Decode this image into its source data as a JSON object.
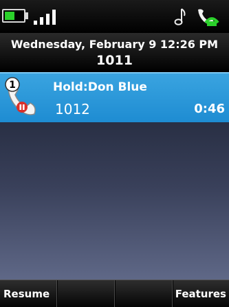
{
  "status": {
    "battery_level": 0.55,
    "signal_bars": 4,
    "icons": [
      "battery-icon",
      "signal-icon",
      "music-note-icon",
      "handset-icon"
    ],
    "colors": {
      "battery_fill": "#2bd12b",
      "handset_green": "#2bd12b"
    }
  },
  "header": {
    "datetime": "Wednesday, February 9 12:26 PM",
    "extension": "1011"
  },
  "call": {
    "line_number": "1",
    "title": "Hold:Don Blue",
    "number": "1012",
    "timer": "0:46",
    "icon": "hold-handset-icon",
    "colors": {
      "row_bg": "#2596d8",
      "hold_badge": "#d9302a"
    }
  },
  "softkeys": [
    {
      "label": "Resume"
    },
    {
      "label": ""
    },
    {
      "label": ""
    },
    {
      "label": "Features"
    }
  ]
}
